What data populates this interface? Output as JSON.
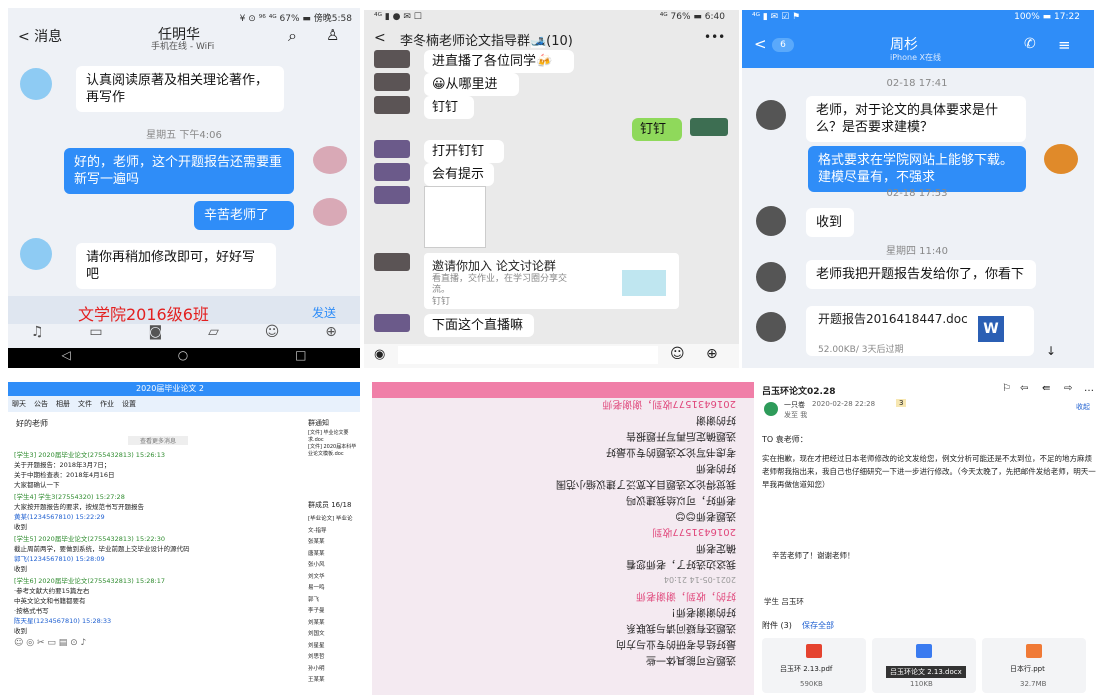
{
  "p1": {
    "status": "¥ ⊙ ⁹⁶ ⁴ᴳ 67% ▬ 傍晚5:58",
    "back": "< 消息",
    "name": "任明华",
    "sub": "手机在线 - WiFi",
    "msgs": [
      "认真阅读原著及相关理论著作，再写作",
      "好的，老师，这个开题报告还需要重新写一遍吗",
      "辛苦老师了",
      "请你再稍加修改即可，好好写吧"
    ],
    "time": "星期五 下午4:06",
    "watermark": "文学院2016级6班",
    "send": "发送"
  },
  "p2": {
    "status": "⁴ᴳ ▮ ● ✉ ☐",
    "status_r": "⁴ᴳ 76% ▬ 6:40",
    "title": "李冬楠老师论文指导群🎿(10)",
    "more": "•••",
    "msgs": [
      "进直播了各位同学🍻",
      "😀从哪里进",
      "钉钉",
      "钉钉",
      "打开钉钉",
      "会有提示",
      "邀请你加入 论文讨论群",
      "看直播，交作业，在学习圈分享交流。",
      "钉钉",
      "下面这个直播嘛"
    ]
  },
  "p3": {
    "status": "⁴ᴳ ▮ ✉ ☑ ⚑",
    "status_r": "100% ▬ 17:22",
    "badge": "6",
    "name": "周杉",
    "sub": "iPhone X在线",
    "t1": "02-18 17:41",
    "m1": "老师，对于论文的具体要求是什么？是否要求建模？",
    "m2": "格式要求在学院网站上能够下载。建模尽量有，不强求",
    "t2": "02-18 17:53",
    "m3": "收到",
    "t3": "星期四 11:40",
    "m4": "老师我把开题报告发给你了，你看下",
    "file": "开题报告2016418447.doc",
    "fsize": "52.00KB/ 3天后过期",
    "word": "W"
  },
  "p4": {
    "title": "2020届毕业论文 2",
    "tabs": [
      "聊天",
      "公告",
      "相册",
      "文件",
      "作业",
      "设置"
    ],
    "chat_title": "好的老师",
    "bar": "查看更多消息",
    "lines": [
      "[学生3] 2020届毕业论文(2755432813) 15:26:13",
      "关于开题报告：2018年3月7日；",
      "关于中期检查表：2018年4月16日",
      "大家都确认一下",
      "[学生4] 学生3(27554320) 15:27:28",
      "大家按开题报告的要求，按规范书写开题报告",
      "黄某(1234567810) 15:22:29",
      "收到",
      "[学生5] 2020届毕业论文(2755432813) 15:22:30",
      "截止周前两学，要做到系统，毕业前题上交毕业设计的源代码",
      "郭飞(1234567810) 15:28:09",
      "收到",
      "[学生6] 2020届毕业论文(2755432813) 15:28:17",
      "·参考文献大约要15篇左右",
      "中英文论文和书籍都要有",
      "·按格式书写",
      "陈天星(1234567810) 15:28:33",
      "收到"
    ],
    "notice_head": "群通知",
    "notices": [
      "[文件] 毕业论文要求.doc",
      "[文件] 2020届本科毕业论文模板.doc"
    ],
    "members_head": "群成员 16/18",
    "members": [
      "[毕业论文] 毕业论文-指导",
      "张某某",
      "唐某某",
      "张小风",
      "刘文华",
      "易一鸣",
      "郭飞",
      "李子曼",
      "刘某某",
      "刘国文",
      "刘星星",
      "刘思哲",
      "孙小明",
      "王某某"
    ],
    "icons": "☺ ◎ ✂ ▭ ▤ ⊙ ♪"
  },
  "p5": {
    "rows": [
      "选题尽可能具体一些",
      "最好结合考研的专业与方向",
      "选题还有疑问请与我联系",
      "好的谢谢老师！",
      "好的，收到，谢谢老师",
      "2021-05-14 21:04",
      "我这边选好了，老师您看",
      "确定老师",
      "2016431577收到",
      "选题老师😊😊",
      "老师好，可以给我建议吗",
      "我觉得论文选题目太宽泛了建议缩小范围",
      "好的老师",
      "考虑书写论文选题的专业最好",
      "选题确定后再写开题报告",
      "好的谢谢",
      "2016431577收到，谢谢老师",
      "2016431069 选题 文学院 2016级 xx班"
    ]
  },
  "p6": {
    "title": "吕玉环论文02.28",
    "sender": "一只卷",
    "date": "2020-02-28 22:28",
    "badge": "3",
    "to": "发至 我",
    "reply": "收起",
    "greet": "TO 袁老师：",
    "body": "实在抱歉，现在才把经过日本老师修改的论文发给您，例文分析可能还是不太到位，不足的地方麻烦老师帮我指出来，我自己也仔细研究一下进一步进行修改。（今天太晚了，先把邮件发给老师，明天一早我再做信道知您）",
    "thanks": "辛苦老师了！谢谢老师！",
    "sign": "学生 吕玉环",
    "att": "附件 (3)",
    "saveall": "保存全部",
    "files": [
      {
        "name": "吕玉环 2.13.pdf",
        "size": "590KB",
        "color": "#e5432f"
      },
      {
        "name": "吕玉环论文 2.13.docx",
        "size": "110KB",
        "color": "#3a7bf0"
      },
      {
        "name": "日本行.ppt",
        "size": "32.7MB",
        "color": "#f07a36"
      }
    ],
    "tooltip": "吕玉环论文 2.13.docx"
  }
}
